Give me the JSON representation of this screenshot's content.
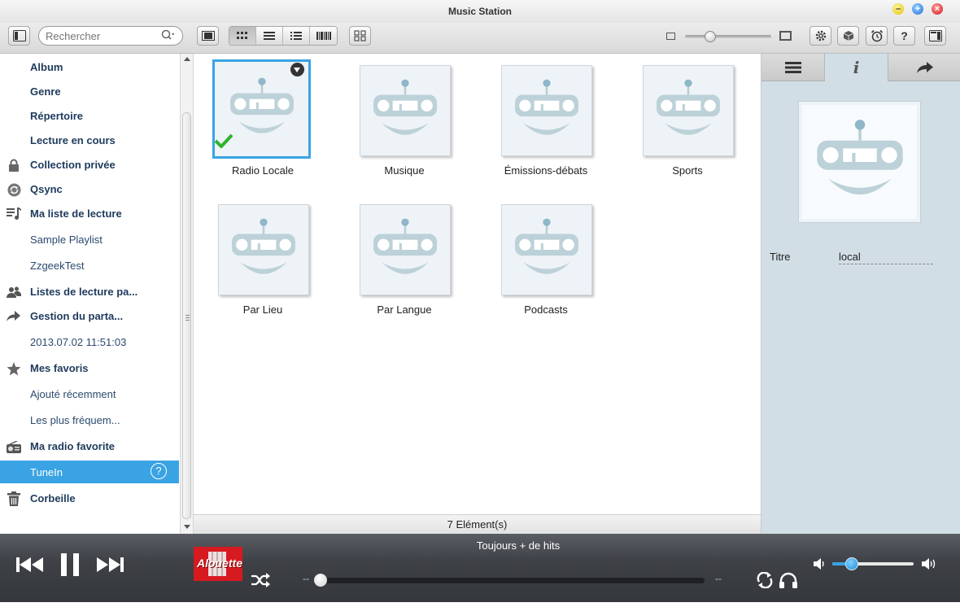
{
  "window": {
    "title": "Music Station"
  },
  "toolbar": {
    "search_placeholder": "Rechercher"
  },
  "sidebar": {
    "items": [
      {
        "label": "Album",
        "style": "bold",
        "icon": ""
      },
      {
        "label": "Genre",
        "style": "bold",
        "icon": ""
      },
      {
        "label": "Répertoire",
        "style": "bold",
        "icon": ""
      },
      {
        "label": "Lecture en cours",
        "style": "bold",
        "icon": ""
      },
      {
        "label": "Collection privée",
        "style": "bold",
        "icon": "lock-icon"
      },
      {
        "label": "Qsync",
        "style": "bold",
        "icon": "sync-icon"
      },
      {
        "label": "Ma liste de lecture",
        "style": "bold",
        "icon": "playlist-icon"
      },
      {
        "label": "Sample Playlist",
        "style": "sub",
        "icon": ""
      },
      {
        "label": "ZzgeekTest",
        "style": "sub",
        "icon": ""
      },
      {
        "label": "Listes de lecture pa...",
        "style": "bold",
        "icon": "users-icon"
      },
      {
        "label": "Gestion du parta...",
        "style": "bold",
        "icon": "share-arrow-icon"
      },
      {
        "label": "2013.07.02 11:51:03",
        "style": "sub",
        "icon": ""
      },
      {
        "label": "Mes favoris",
        "style": "bold",
        "icon": "star-icon"
      },
      {
        "label": "Ajouté récemment",
        "style": "sub",
        "icon": ""
      },
      {
        "label": "Les plus fréquem...",
        "style": "sub",
        "icon": ""
      },
      {
        "label": "Ma radio favorite",
        "style": "bold",
        "icon": "radio-icon"
      },
      {
        "label": "TuneIn",
        "style": "sub",
        "icon": "",
        "active": true,
        "badge": "?"
      },
      {
        "label": "Corbeille",
        "style": "bold",
        "icon": "trash-icon"
      }
    ]
  },
  "content": {
    "tiles": [
      {
        "name": "Radio Locale",
        "selected": true
      },
      {
        "name": "Musique"
      },
      {
        "name": "Émissions-débats"
      },
      {
        "name": "Sports"
      },
      {
        "name": "Par Lieu"
      },
      {
        "name": "Par Langue"
      },
      {
        "name": "Podcasts"
      }
    ],
    "status": "7 Elément(s)"
  },
  "info_panel": {
    "field_label": "Titre",
    "field_value": "local"
  },
  "player": {
    "now_playing": "Toujours + de hits",
    "time_elapsed": "--",
    "time_total": "--",
    "progress": 0,
    "volume": 0.24,
    "station_logo_text": "Alouette"
  },
  "colors": {
    "accent": "#3aa3e3",
    "sidebar_bold": "#1e3a5c",
    "info_panel_bg": "#d2dee6",
    "player_bg": "#3e4146"
  }
}
